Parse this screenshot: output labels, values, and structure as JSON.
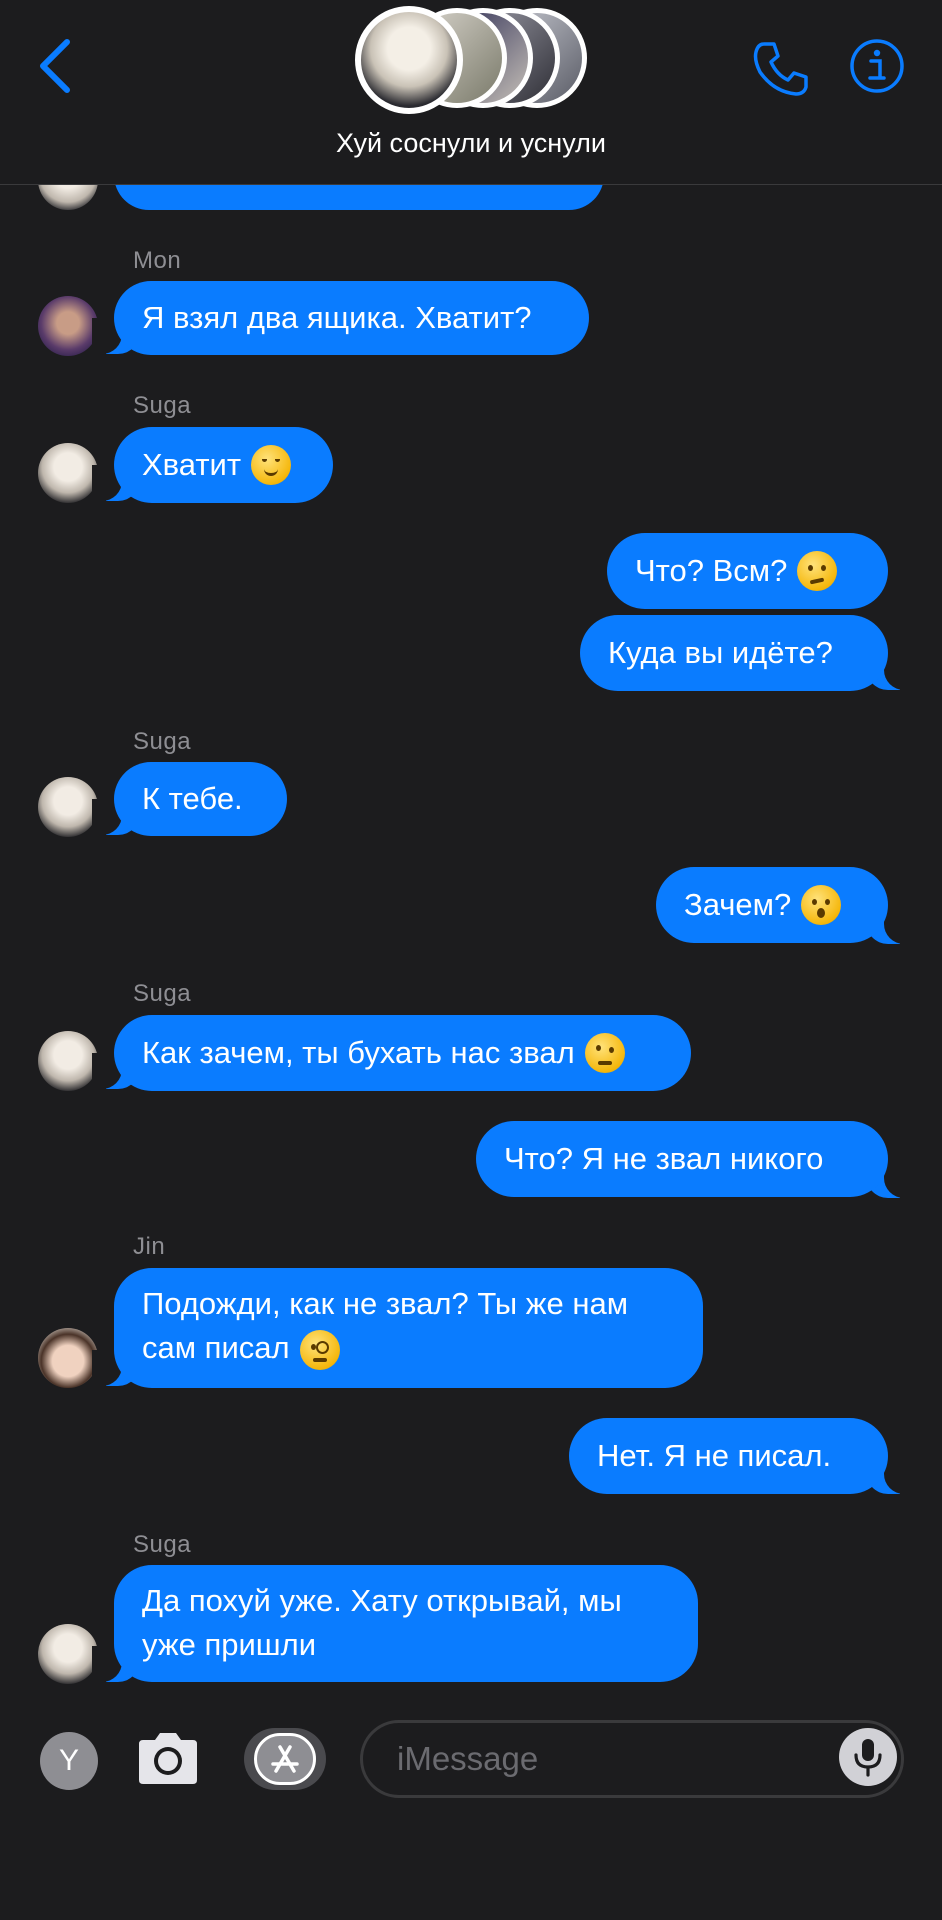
{
  "header": {
    "title": "Хуй соснули и уснули",
    "back_icon": "chevron-left-icon",
    "phone_icon": "phone-icon",
    "info_icon": "info-icon",
    "accent": "#0a7cff"
  },
  "messages": [
    {
      "sender": "",
      "direction": "in",
      "text": ""
    },
    {
      "sender": "Mon",
      "direction": "in",
      "text": "Я взял два ящика. Хватит?"
    },
    {
      "sender": "Suga",
      "direction": "in",
      "text": "Хватит"
    },
    {
      "sender": "",
      "direction": "out",
      "text": "Что? Всм?"
    },
    {
      "sender": "",
      "direction": "out",
      "text": "Куда вы идёте?"
    },
    {
      "sender": "Suga",
      "direction": "in",
      "text": "К тебе."
    },
    {
      "sender": "",
      "direction": "out",
      "text": "Зачем?"
    },
    {
      "sender": "Suga",
      "direction": "in",
      "text": "Как зачем, ты бухать нас звал"
    },
    {
      "sender": "",
      "direction": "out",
      "text": "Что? Я не звал никого"
    },
    {
      "sender": "Jin",
      "direction": "in",
      "lines": [
        "Подожди, как не звал? Ты же нам",
        "сам писал"
      ]
    },
    {
      "sender": "",
      "direction": "out",
      "text": "Нет. Я не писал."
    },
    {
      "sender": "Suga",
      "direction": "in",
      "lines": [
        "Да похуй уже. Хату открывай, мы",
        "уже пришли"
      ]
    }
  ],
  "composer": {
    "avatar_letter": "Y",
    "camera_icon": "camera-icon",
    "appstore_icon": "app-store-icon",
    "placeholder": "iMessage",
    "mic_icon": "microphone-icon"
  },
  "colors": {
    "bubble": "#0a7cff",
    "background": "#1c1c1e",
    "sender_text": "#8e8e93"
  }
}
